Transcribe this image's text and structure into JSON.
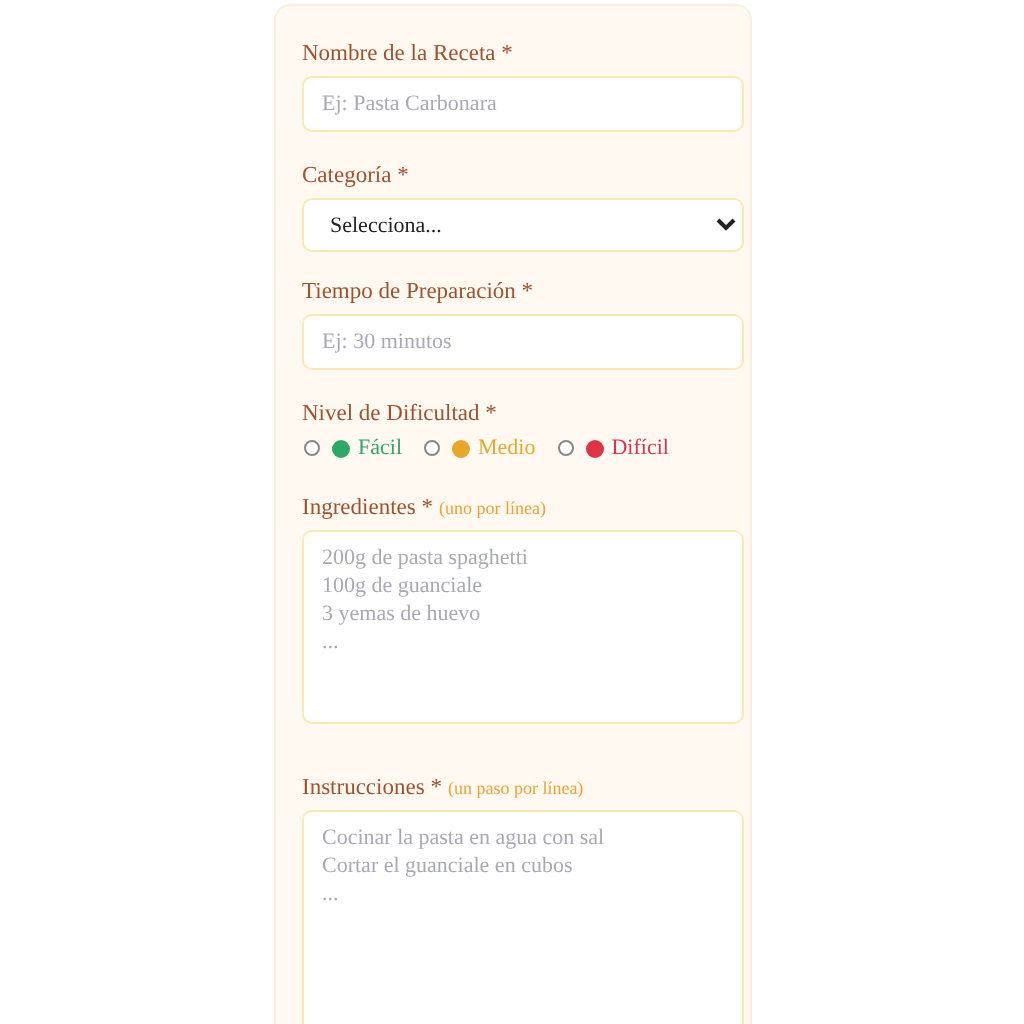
{
  "form": {
    "fields": [
      {
        "kind": "text",
        "label": "Nombre de la Receta *",
        "placeholder": "Ej: Pasta Carbonara"
      },
      {
        "kind": "select",
        "label": "Categoría *",
        "value": "Selecciona..."
      },
      {
        "kind": "text",
        "label": "Tiempo de Preparación *",
        "placeholder": "Ej: 30 minutos"
      },
      {
        "kind": "radio",
        "label": "Nivel de Dificultad *",
        "options": [
          {
            "label": "Fácil",
            "color": "#2ea866",
            "selected": false
          },
          {
            "label": "Medio",
            "color": "#e6a72a",
            "selected": false
          },
          {
            "label": "Difícil",
            "color": "#e0334a",
            "selected": false
          }
        ]
      },
      {
        "kind": "textarea",
        "label": "Ingredientes *",
        "hint": "(uno por línea)",
        "placeholder": "200g de pasta spaghetti\n100g de guanciale\n3 yemas de huevo\n..."
      },
      {
        "kind": "textarea",
        "label": "Instrucciones *",
        "hint": "(un paso por línea)",
        "placeholder": "Cocinar la pasta en agua con sal\nCortar el guanciale en cubos\n..."
      }
    ]
  }
}
